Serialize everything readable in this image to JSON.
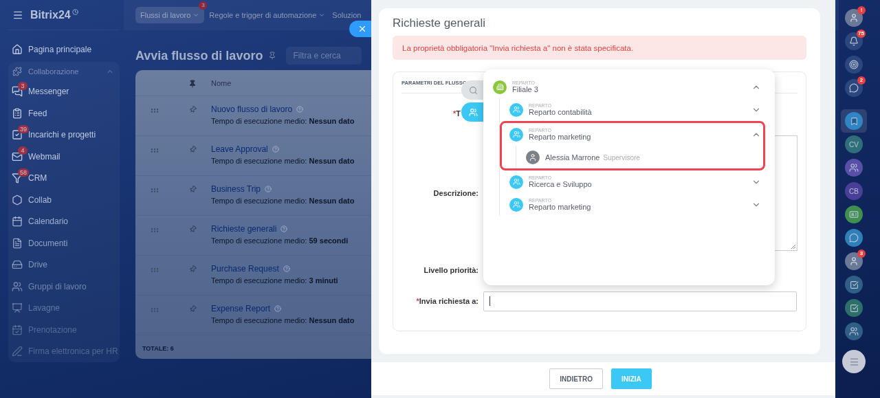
{
  "logo": {
    "name": "Bitrix24"
  },
  "sidebar": {
    "home": {
      "label": "Pagina principale"
    },
    "group": {
      "label": "Collaborazione",
      "expanded": true,
      "items": [
        {
          "label": "Messenger",
          "badge": "3"
        },
        {
          "label": "Feed"
        },
        {
          "label": "Incarichi e progetti",
          "badge": "39"
        },
        {
          "label": "Webmail",
          "badge": "4"
        },
        {
          "label": "CRM",
          "badge": "58"
        },
        {
          "label": "Collab"
        },
        {
          "label": "Calendario"
        },
        {
          "label": "Documenti"
        },
        {
          "label": "Drive"
        },
        {
          "label": "Gruppi di lavoro"
        },
        {
          "label": "Lavagne"
        },
        {
          "label": "Prenotazione"
        },
        {
          "label": "Firma elettronica per HR"
        }
      ]
    }
  },
  "top_tabs": [
    {
      "label": "Flussi di lavoro",
      "selected": true,
      "badge": "3"
    },
    {
      "label": "Regole e trigger di automazione",
      "selected": false
    },
    {
      "label": "Soluzion",
      "selected": false
    }
  ],
  "page": {
    "title": "Avvia flusso di lavoro",
    "search": {
      "placeholder": "Filtra e cerca"
    },
    "table": {
      "columns": [
        "Nome"
      ],
      "rows": [
        {
          "name": "Nuovo flusso di lavoro",
          "meta": "Tempo di esecuzione medio: **Nessun dato**"
        },
        {
          "name": "Leave Approval",
          "meta": "Tempo di esecuzione medio: **Nessun dato**"
        },
        {
          "name": "Business Trip",
          "meta": "Tempo di esecuzione medio: **Nessun dato**"
        },
        {
          "name": "Richieste generali",
          "meta": "Tempo di esecuzione medio: **59 secondi**"
        },
        {
          "name": "Purchase Request",
          "meta": "Tempo di esecuzione medio: **3 minuti**"
        },
        {
          "name": "Expense Report",
          "meta": "Tempo di esecuzione medio: **Nessun dato**"
        }
      ],
      "total": "TOTALE: 6"
    }
  },
  "panel": {
    "title": "Richieste generali",
    "error": "La proprietà obbligatoria \"Invia richiesta a\" non è stata specificata.",
    "section": "PARAMETRI DEL FLUSSO",
    "fields": [
      {
        "mark": "*",
        "label": "T"
      },
      {
        "label": "Descrizione:",
        "kind": "textarea"
      },
      {
        "label": "Livello priorità:"
      },
      {
        "mark": "*",
        "label": "Invia richiesta a:",
        "kind": "input"
      }
    ],
    "buttons": [
      {
        "label": "INDIETRO",
        "primary": false
      },
      {
        "label": "INIZIA",
        "primary": true
      }
    ]
  },
  "picker": {
    "tabs": [
      {
        "kind": "search",
        "selected": false
      },
      {
        "kind": "people",
        "selected": true
      }
    ],
    "tree": {
      "kind": "branch",
      "type": "REPARTO",
      "name": "Filiale 3",
      "expanded": true,
      "children": [
        {
          "kind": "department",
          "type": "REPARTO",
          "name": "Reparto contabilità",
          "expanded": false
        },
        {
          "kind": "department",
          "type": "REPARTO",
          "name": "Reparto marketing",
          "expanded": true,
          "highlighted": true,
          "children": [
            {
              "kind": "user",
              "name": "Alessia Marrone",
              "role": "Supervisore"
            }
          ]
        },
        {
          "kind": "department",
          "type": "REPARTO",
          "name": "Ricerca e Sviluppo",
          "expanded": false
        },
        {
          "kind": "department",
          "type": "REPARTO",
          "name": "Reparto marketing",
          "expanded": false
        }
      ]
    }
  },
  "rail": [
    {
      "kind": "avatar",
      "badge": "!",
      "selected": false
    },
    {
      "kind": "bell",
      "badge": "75",
      "selected": false
    },
    {
      "kind": "target",
      "selected": false
    },
    {
      "kind": "chat",
      "badge": "2",
      "selected": false
    },
    {
      "kind": "bookmark",
      "selected": true
    },
    {
      "kind": "initials",
      "text": "CV",
      "color": "#2f6f7a",
      "selected": false
    },
    {
      "kind": "group",
      "color": "#5a4fa8",
      "selected": false
    },
    {
      "kind": "initials",
      "text": "CB",
      "color": "#4a3f96",
      "selected": false
    },
    {
      "kind": "card",
      "color": "#3f8f4f",
      "selected": false
    },
    {
      "kind": "chat",
      "color": "#2f7fb8",
      "selected": false
    },
    {
      "kind": "avatar",
      "badge": "3",
      "selected": false
    },
    {
      "kind": "task",
      "color": "#2f5f86",
      "selected": false
    },
    {
      "kind": "task",
      "color": "#2f6f6a",
      "selected": false
    },
    {
      "kind": "group",
      "color": "#2f5f86",
      "selected": false
    },
    {
      "kind": "menu",
      "selected": false
    }
  ]
}
